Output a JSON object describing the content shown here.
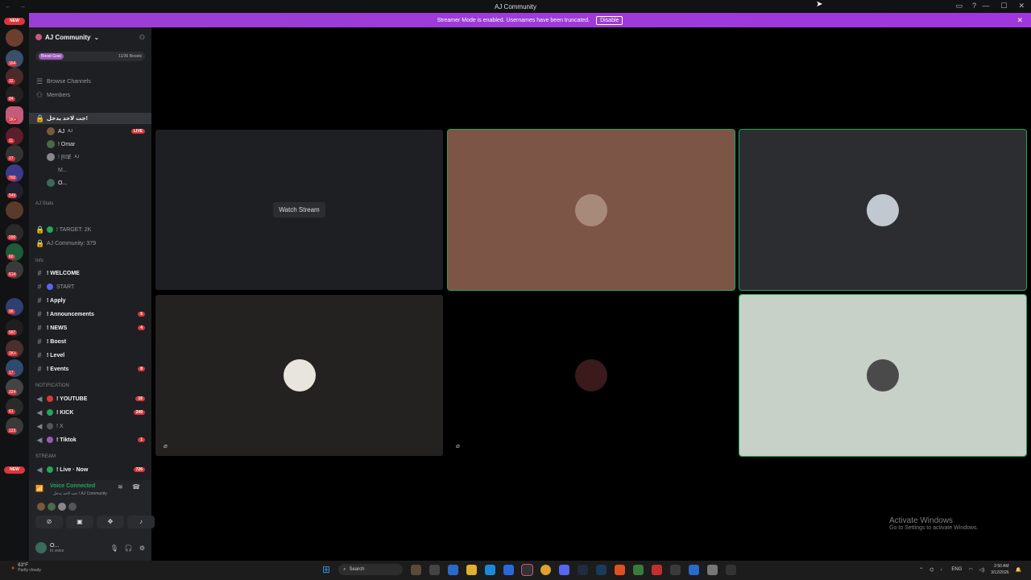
{
  "window": {
    "title": "AJ Community"
  },
  "banner": {
    "text": "Streamer Mode is enabled. Usernames have been truncated.",
    "button": "Disable"
  },
  "servers": {
    "new_top": "NEW",
    "new_bottom": "NEW",
    "badges": [
      "164",
      "32",
      "84",
      "1K+",
      "11",
      "27",
      "760",
      "549",
      "",
      "290",
      "60",
      "614",
      "96",
      "587",
      "1K+",
      "17",
      "324",
      "61",
      "123"
    ]
  },
  "guild": {
    "name": "AJ Community",
    "boost_label": "Boost Goal",
    "boost_count": "11/36 Boosts"
  },
  "nav": {
    "browse": "Browse Channels",
    "members": "Members"
  },
  "voice_channel": {
    "name": "جت لاحد يدخل!",
    "members": [
      {
        "name": "AJ",
        "tag": "AJ",
        "live": "LIVE"
      },
      {
        "name": "! Omar"
      },
      {
        "name": "! Ɽ𝕀Ɇ",
        "tag": "AJ"
      },
      {
        "name": "M..."
      },
      {
        "name": "O..."
      }
    ]
  },
  "stats": {
    "category": "AJ Stats",
    "target": "! TARGET: 2K",
    "community": "AJ Community: 379"
  },
  "info": {
    "category": "Info",
    "channels": [
      {
        "name": "! WELCOME",
        "count": ""
      },
      {
        "name": "START",
        "count": ""
      },
      {
        "name": "! Apply",
        "count": ""
      },
      {
        "name": "! Announcements",
        "count": "6"
      },
      {
        "name": "! NEWS",
        "count": "4"
      },
      {
        "name": "! Boost",
        "count": ""
      },
      {
        "name": "! Level",
        "count": ""
      },
      {
        "name": "! Events",
        "count": "8"
      }
    ]
  },
  "notification": {
    "category": "NOTIFICATION",
    "channels": [
      {
        "name": "! YOUTUBE",
        "count": "16"
      },
      {
        "name": "! KICK",
        "count": "249"
      },
      {
        "name": "! X",
        "count": ""
      },
      {
        "name": "! Tiktok",
        "count": "1"
      }
    ]
  },
  "stream": {
    "category": "STREAM",
    "channel": "! Live · Now",
    "count": "726"
  },
  "voice": {
    "status": "Voice Connected",
    "sub": "جت لاحد يدخل / AJ Community"
  },
  "user": {
    "name": "O...",
    "status": "In voice"
  },
  "grid": {
    "watch": "Watch Stream"
  },
  "activate": {
    "title": "Activate Windows",
    "sub": "Go to Settings to activate Windows."
  },
  "taskbar": {
    "temp": "63°F",
    "weather": "Partly cloudy",
    "search": "Search",
    "lang": "ENG",
    "time": "2:50 AM",
    "date": "3/12/2026"
  },
  "colors": {
    "accent": "#a036de",
    "speaking": "#23a55a",
    "badge": "#da373c",
    "tile_brown": "#7d5547",
    "tile_light": "#c7d1c7",
    "tile_dark": "#2b2d31"
  }
}
